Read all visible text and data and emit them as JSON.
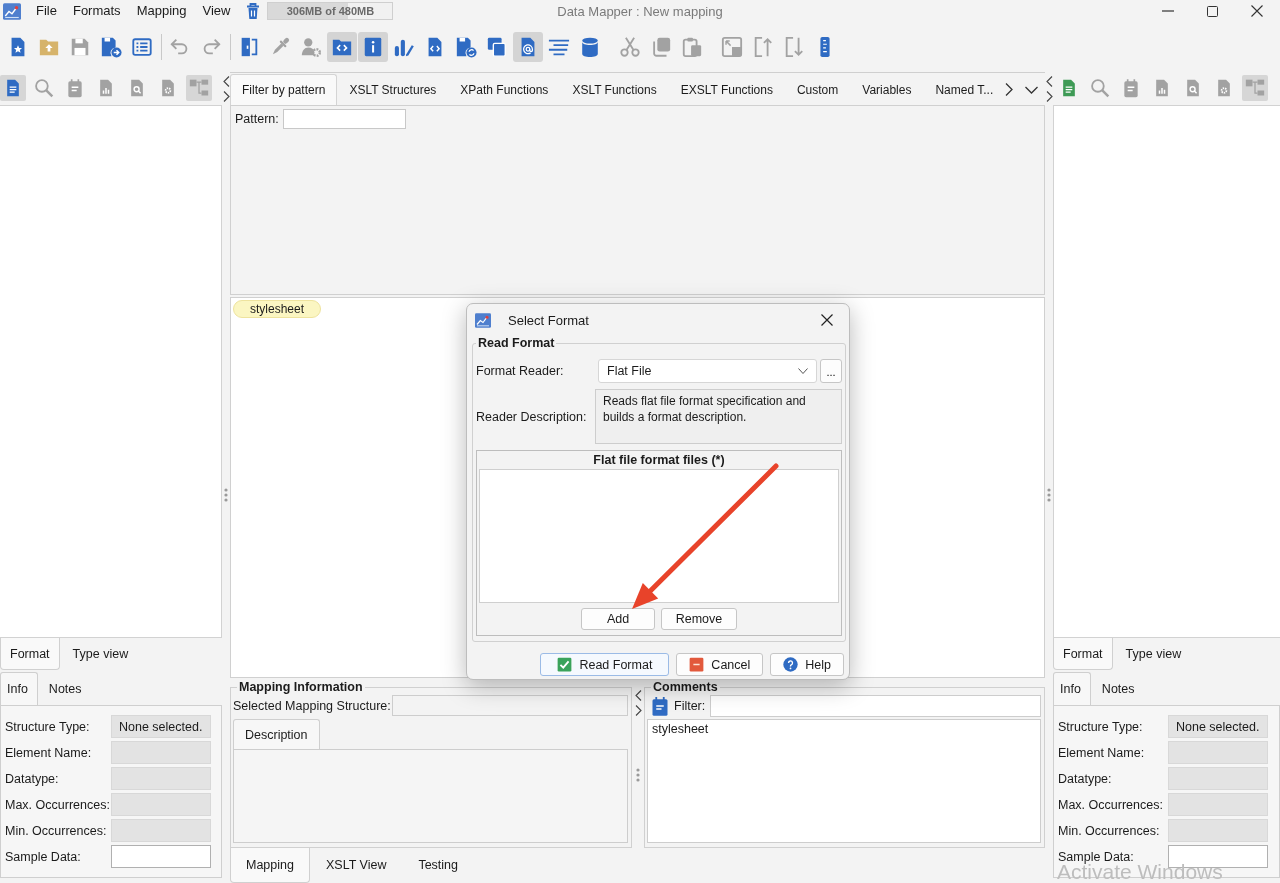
{
  "window": {
    "title": "Data Mapper : New mapping",
    "menu": [
      "File",
      "Formats",
      "Mapping",
      "View"
    ],
    "memory": {
      "text": "306MB of 480MB",
      "level": 0.64
    }
  },
  "toolbar": [
    {
      "kind": "button",
      "on": false,
      "disabled": false
    },
    {
      "kind": "button",
      "on": false,
      "disabled": false
    },
    {
      "kind": "button",
      "on": false,
      "disabled": true
    },
    {
      "kind": "button",
      "on": false,
      "disabled": false
    },
    {
      "kind": "button",
      "on": false,
      "disabled": false
    },
    {
      "kind": "separator"
    },
    {
      "kind": "button",
      "on": false,
      "disabled": true
    },
    {
      "kind": "button",
      "on": false,
      "disabled": true
    },
    {
      "kind": "separator"
    },
    {
      "kind": "button",
      "on": false,
      "disabled": false
    },
    {
      "kind": "button",
      "on": false,
      "disabled": true
    },
    {
      "kind": "button",
      "on": false,
      "disabled": true
    },
    {
      "kind": "button",
      "on": true,
      "disabled": false
    },
    {
      "kind": "button",
      "on": true,
      "disabled": false
    },
    {
      "kind": "button",
      "on": false,
      "disabled": false
    },
    {
      "kind": "button",
      "on": false,
      "disabled": false
    },
    {
      "kind": "button",
      "on": false,
      "disabled": false
    },
    {
      "kind": "button",
      "on": false,
      "disabled": false
    },
    {
      "kind": "button",
      "on": true,
      "disabled": false
    },
    {
      "kind": "button",
      "on": false,
      "disabled": false
    },
    {
      "kind": "button",
      "on": false,
      "disabled": false
    },
    {
      "kind": "gap"
    },
    {
      "kind": "button",
      "on": false,
      "disabled": true
    },
    {
      "kind": "button",
      "on": false,
      "disabled": true
    },
    {
      "kind": "button",
      "on": false,
      "disabled": true
    },
    {
      "kind": "gap"
    },
    {
      "kind": "button",
      "on": false,
      "disabled": true
    },
    {
      "kind": "button",
      "on": false,
      "disabled": true
    },
    {
      "kind": "button",
      "on": false,
      "disabled": true
    },
    {
      "kind": "button",
      "on": false,
      "disabled": false
    }
  ],
  "left_panel": {
    "toolbar": [
      {
        "on": true,
        "disabled": false
      },
      {
        "on": false,
        "disabled": true
      },
      {
        "on": false,
        "disabled": true
      },
      {
        "on": false,
        "disabled": true
      },
      {
        "on": false,
        "disabled": true
      },
      {
        "on": false,
        "disabled": true
      },
      {
        "on": true,
        "disabled": true
      }
    ],
    "tabs": [
      {
        "label": "Format",
        "selected": true
      },
      {
        "label": "Type view",
        "selected": false
      }
    ],
    "info_tabs": [
      {
        "label": "Info",
        "selected": true
      },
      {
        "label": "Notes",
        "selected": false
      }
    ],
    "fields": [
      {
        "label": "Structure Type:",
        "value": "None selected.",
        "readonly": true
      },
      {
        "label": "Element Name:",
        "readonly": true
      },
      {
        "label": "Datatype:",
        "readonly": true
      },
      {
        "label": "Max. Occurrences:",
        "readonly": true
      },
      {
        "label": "Min. Occurrences:",
        "readonly": true
      },
      {
        "label": "Sample Data:",
        "readonly": false
      }
    ]
  },
  "function_tabs": [
    {
      "label": "Filter by pattern",
      "selected": true
    },
    {
      "label": "XSLT Structures",
      "selected": false
    },
    {
      "label": "XPath Functions",
      "selected": false
    },
    {
      "label": "XSLT Functions",
      "selected": false
    },
    {
      "label": "EXSLT Functions",
      "selected": false
    },
    {
      "label": "Custom",
      "selected": false
    },
    {
      "label": "Variables",
      "selected": false
    },
    {
      "label": "Named T...",
      "selected": false
    }
  ],
  "pattern": {
    "label": "Pattern:"
  },
  "canvas": {
    "nodes": [
      {
        "label": "stylesheet"
      }
    ]
  },
  "mapping_information": {
    "title": "Mapping Information",
    "structure_label": "Selected Mapping Structure:",
    "tabs": [
      {
        "label": "Description",
        "selected": true
      }
    ]
  },
  "comments": {
    "title": "Comments",
    "filter_label": "Filter:",
    "items": [
      "stylesheet"
    ]
  },
  "bottom_tabs": [
    {
      "label": "Mapping",
      "selected": true
    },
    {
      "label": "XSLT View",
      "selected": false
    },
    {
      "label": "Testing",
      "selected": false
    }
  ],
  "right_panel": {
    "toolbar": [
      {
        "on": false,
        "disabled": false
      },
      {
        "on": false,
        "disabled": true
      },
      {
        "on": false,
        "disabled": true
      },
      {
        "on": false,
        "disabled": true
      },
      {
        "on": false,
        "disabled": true
      },
      {
        "on": false,
        "disabled": true
      },
      {
        "on": true,
        "disabled": true
      }
    ],
    "tabs": [
      {
        "label": "Format",
        "selected": true
      },
      {
        "label": "Type view",
        "selected": false
      }
    ],
    "info_tabs": [
      {
        "label": "Info",
        "selected": true
      },
      {
        "label": "Notes",
        "selected": false
      }
    ],
    "fields": [
      {
        "label": "Structure Type:",
        "value": "None selected.",
        "readonly": true
      },
      {
        "label": "Element Name:",
        "readonly": true
      },
      {
        "label": "Datatype:",
        "readonly": true
      },
      {
        "label": "Max. Occurrences:",
        "readonly": true
      },
      {
        "label": "Min. Occurrences:",
        "readonly": true
      },
      {
        "label": "Sample Data:",
        "readonly": false
      }
    ]
  },
  "dialog": {
    "title": "Select Format",
    "group": "Read Format",
    "reader_label": "Format Reader:",
    "reader_value": "Flat File",
    "browse_button": "...",
    "description_label": "Reader Description:",
    "description": "Reads flat file format specification and builds a format description.",
    "files_header": "Flat file format files (*)",
    "list_buttons": [
      "Add",
      "Remove"
    ],
    "buttons": [
      {
        "kind": "ok",
        "label": "Read Format",
        "default": true
      },
      {
        "kind": "cancel",
        "label": "Cancel",
        "default": false
      },
      {
        "kind": "help",
        "label": "Help",
        "default": false
      }
    ]
  },
  "os_notice": "Activate Windows"
}
